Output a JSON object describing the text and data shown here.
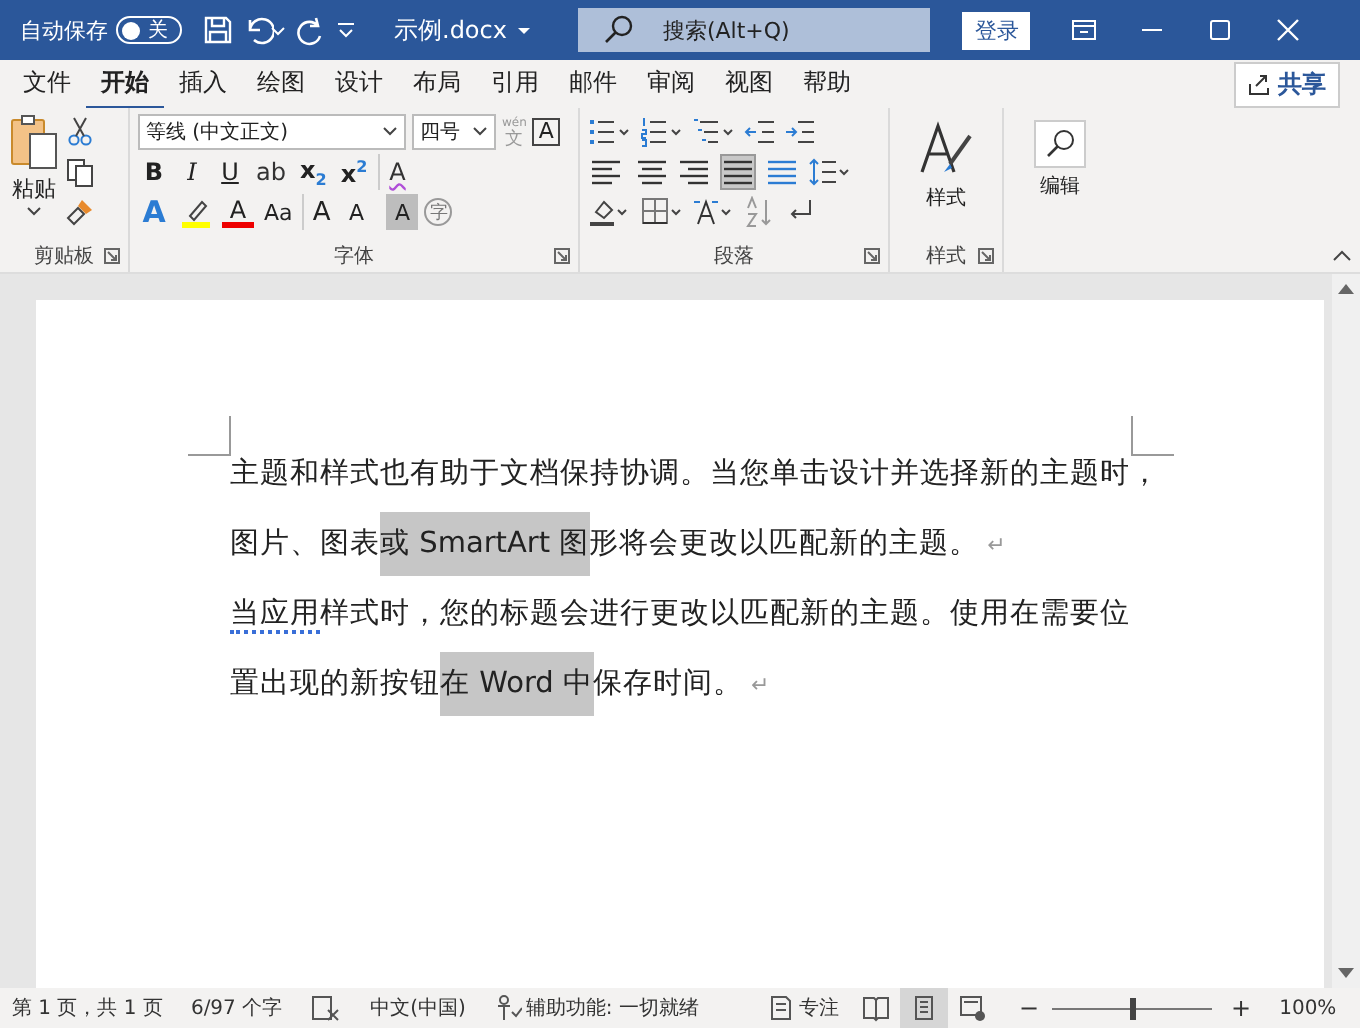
{
  "title_bar": {
    "autosave_label": "自动保存",
    "autosave": {
      "on": false,
      "label": "关"
    },
    "file_name": "示例.docx",
    "search": {
      "placeholder": "搜索(Alt+Q)"
    },
    "login": "登录"
  },
  "tabs": [
    {
      "label": "文件",
      "selected": false
    },
    {
      "label": "开始",
      "selected": true
    },
    {
      "label": "插入",
      "selected": false
    },
    {
      "label": "绘图",
      "selected": false
    },
    {
      "label": "设计",
      "selected": false
    },
    {
      "label": "布局",
      "selected": false
    },
    {
      "label": "引用",
      "selected": false
    },
    {
      "label": "邮件",
      "selected": false
    },
    {
      "label": "审阅",
      "selected": false
    },
    {
      "label": "视图",
      "selected": false
    },
    {
      "label": "帮助",
      "selected": false
    }
  ],
  "share": "共享",
  "ribbon": {
    "clipboard": {
      "paste": "粘贴",
      "label": "剪贴板"
    },
    "font": {
      "font_name": "等线 (中文正文)",
      "font_size": "四号",
      "phonetic": {
        "ruby": "wén",
        "label": "文"
      },
      "border_label": "A",
      "label": "字体",
      "row_1": [
        {
          "kind": "bold",
          "label": "B"
        },
        {
          "kind": "italic",
          "label": "I"
        },
        {
          "kind": "underline",
          "label": "U"
        },
        {
          "kind": "strike",
          "label": "ab"
        },
        {
          "kind": "script",
          "label": "x$_{2}$"
        },
        {
          "kind": "script",
          "label": "x$^{2}$"
        },
        {
          "kind": "clear",
          "label": "A"
        }
      ],
      "row_2": [
        {
          "kind": "effects",
          "label": "A"
        },
        {
          "kind": "highlight"
        },
        {
          "kind": "color",
          "label": "A"
        },
        {
          "kind": "case",
          "label": "Aa"
        },
        {
          "kind": "grow",
          "label": "A"
        },
        {
          "kind": "shrink",
          "label": "A"
        },
        {
          "kind": "shading",
          "label": "A"
        },
        {
          "kind": "enclose",
          "label": "字"
        }
      ]
    },
    "paragraph": {
      "label": "段落",
      "alignments": [
        {
          "kind": "left",
          "selected": false
        },
        {
          "kind": "center",
          "selected": false
        },
        {
          "kind": "right",
          "selected": false
        },
        {
          "kind": "justify",
          "selected": true
        },
        {
          "kind": "distributed",
          "selected": false
        }
      ]
    },
    "styles": {
      "button": "样式",
      "label": "样式"
    },
    "editing": {
      "button": "编辑"
    }
  },
  "document": {
    "paragraphs": [
      {
        "mark": "↵",
        "lines": [
          [
            {
              "text": "主题和样式也有助于文档保持协调。当您单击设计并选择新的主题时，",
              "highlighted": false,
              "underlined": false
            }
          ],
          [
            {
              "text": "图片、图表",
              "highlighted": false,
              "underlined": false
            },
            {
              "text": "或 SmartArt 图",
              "highlighted": true,
              "underlined": false
            },
            {
              "text": "形将会更改以匹配新的主题。",
              "highlighted": false,
              "underlined": false
            }
          ]
        ]
      },
      {
        "mark": "↵",
        "lines": [
          [
            {
              "text": "当应用",
              "highlighted": false,
              "underlined": true
            },
            {
              "text": "样式时，您的标题会进行更改以匹配新的主题。使用在需要位",
              "highlighted": false,
              "underlined": false
            }
          ],
          [
            {
              "text": "置出现的新按钮",
              "highlighted": false,
              "underlined": false
            },
            {
              "text": "在 Word 中",
              "highlighted": true,
              "underlined": false
            },
            {
              "text": "保存时间。",
              "highlighted": false,
              "underlined": false
            }
          ]
        ]
      }
    ]
  },
  "status_bar": {
    "page": "第 1 页，共 1 页",
    "words": "6/97 个字",
    "language": "中文(中国)",
    "accessibility": "辅助功能: 一切就绪",
    "focus": "专注",
    "views": [
      {
        "kind": "read",
        "selected": false
      },
      {
        "kind": "print",
        "selected": true
      },
      {
        "kind": "web",
        "selected": false
      }
    ],
    "zoom": {
      "minus": "−",
      "plus": "+",
      "level": 0.5,
      "percent": "100%"
    }
  }
}
